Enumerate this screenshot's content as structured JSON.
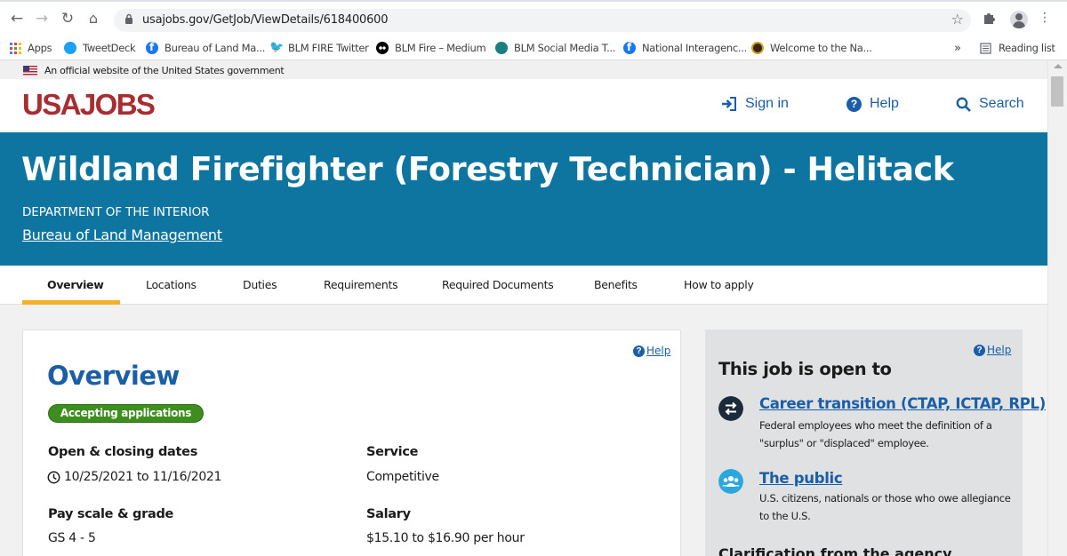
{
  "browser": {
    "url": "usajobs.gov/GetJob/ViewDetails/618400600",
    "bookmarks": [
      {
        "label": "Apps",
        "icon": "apps-grid-icon"
      },
      {
        "label": "TweetDeck",
        "icon": "tweetdeck-icon"
      },
      {
        "label": "Bureau of Land Ma...",
        "icon": "facebook-icon"
      },
      {
        "label": "BLM FIRE Twitter",
        "icon": "twitter-icon"
      },
      {
        "label": "BLM Fire – Medium",
        "icon": "medium-icon"
      },
      {
        "label": "BLM Social Media T...",
        "icon": "social-media-icon"
      },
      {
        "label": "National Interagenc...",
        "icon": "facebook-icon"
      },
      {
        "label": "Welcome to the Na...",
        "icon": "nps-icon"
      }
    ],
    "overflow": "»",
    "reading_list": "Reading list"
  },
  "gov_banner": "An official website of the United States government",
  "header": {
    "logo": "USAJOBS",
    "sign_in": "Sign in",
    "help": "Help",
    "search": "Search"
  },
  "job": {
    "title": "Wildland Firefighter (Forestry Technician) - Helitack",
    "department": "DEPARTMENT OF THE INTERIOR",
    "agency": "Bureau of Land Management"
  },
  "tabs": [
    {
      "label": "Overview",
      "active": true
    },
    {
      "label": "Locations"
    },
    {
      "label": "Duties"
    },
    {
      "label": "Requirements"
    },
    {
      "label": "Required Documents"
    },
    {
      "label": "Benefits"
    },
    {
      "label": "How to apply"
    }
  ],
  "overview": {
    "help": "Help",
    "heading": "Overview",
    "status": "Accepting applications",
    "dates_label": "Open & closing dates",
    "dates_value": "10/25/2021 to 11/16/2021",
    "service_label": "Service",
    "service_value": "Competitive",
    "pay_label": "Pay scale & grade",
    "pay_value": "GS 4 - 5",
    "salary_label": "Salary",
    "salary_value": "$15.10 to $16.90 per hour"
  },
  "open_to": {
    "help": "Help",
    "heading": "This job is open to",
    "items": [
      {
        "title": "Career transition (CTAP, ICTAP, RPL)",
        "desc": "Federal employees who meet the definition of a \"surplus\" or \"displaced\" employee."
      },
      {
        "title": "The public",
        "desc": "U.S. citizens, nationals or those who owe allegiance to the U.S."
      }
    ],
    "more": "Clarification from the agency"
  },
  "colors": {
    "brand_red": "#a72d30",
    "hero_blue": "#0e74a0",
    "link_blue": "#1a5ea8",
    "status_green": "#3d8d1f",
    "tab_accent": "#f3b129"
  }
}
